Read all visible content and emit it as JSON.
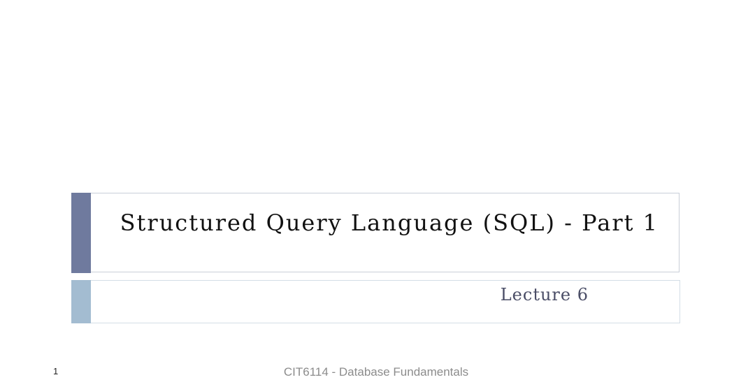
{
  "slide": {
    "title": "Structured Query Language (SQL) - Part 1",
    "subtitle": "Lecture 6",
    "slide_number": "1",
    "footer": "CIT6114 - Database Fundamentals"
  }
}
